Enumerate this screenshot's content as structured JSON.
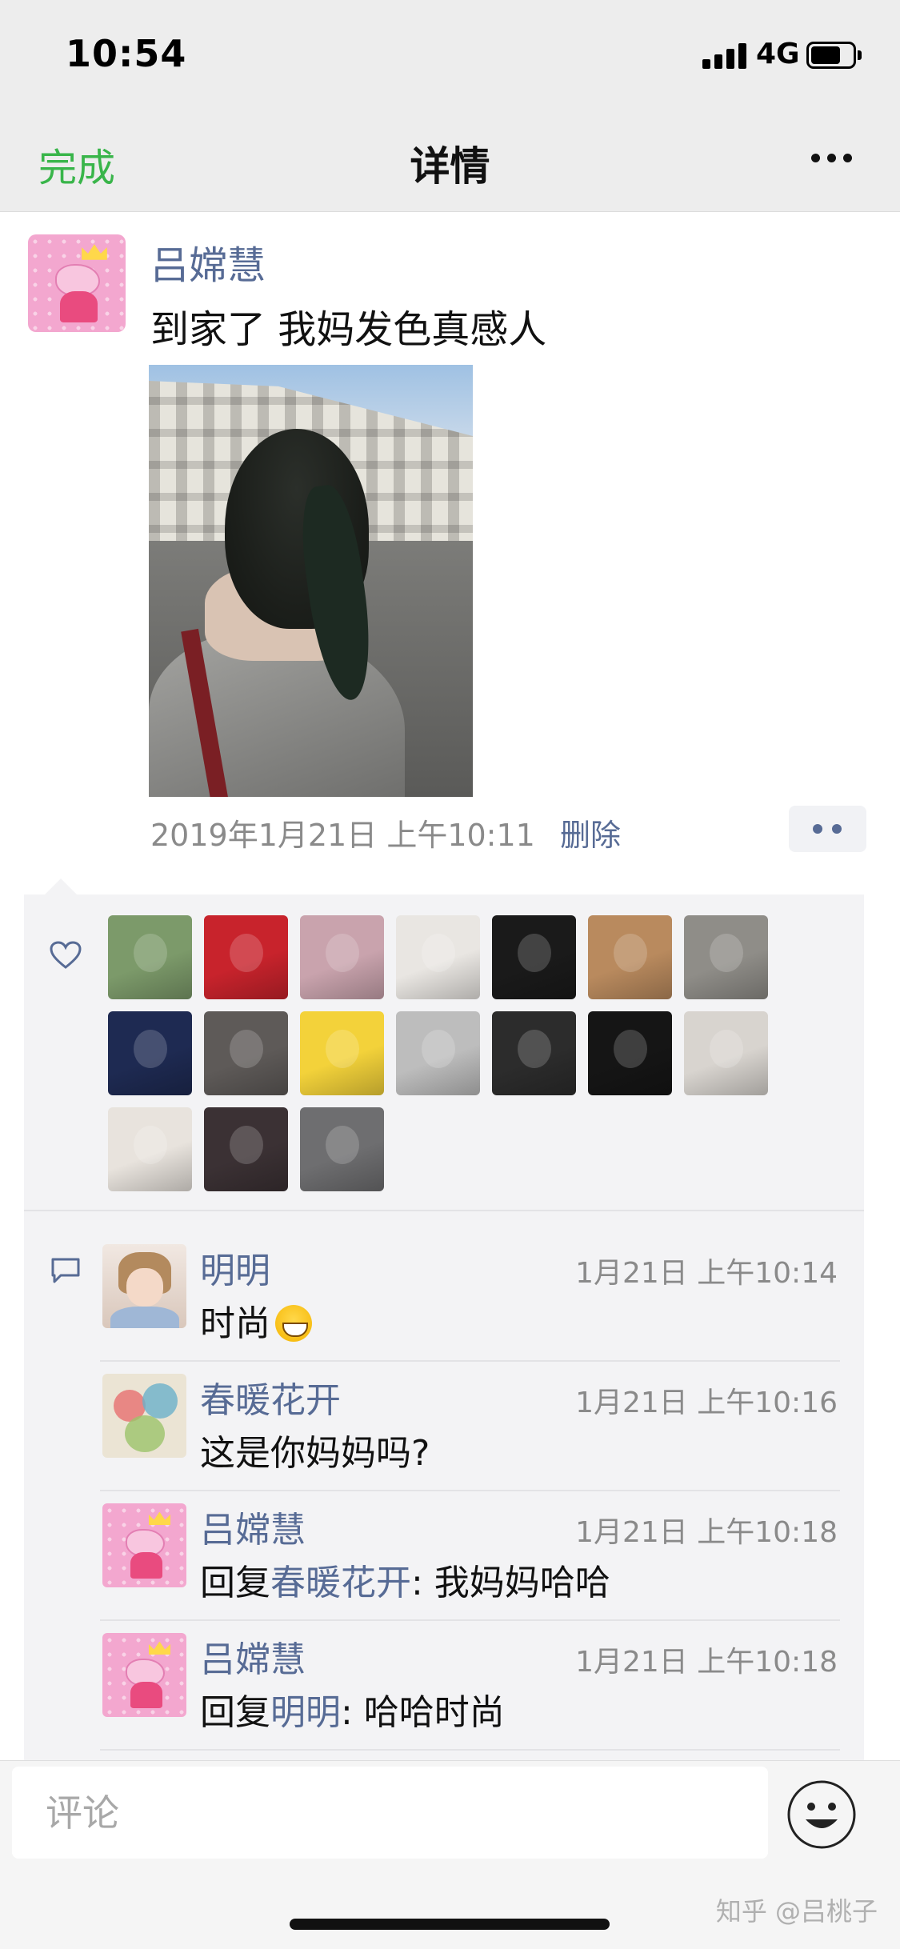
{
  "status_bar": {
    "time": "10:54",
    "network": "4G",
    "battery_level": 0.72
  },
  "nav": {
    "done_label": "完成",
    "title": "详情",
    "more_icon": "more-dots-icon"
  },
  "post": {
    "author": "吕嫦慧",
    "text": "到家了 我妈发色真感人",
    "timestamp": "2019年1月21日 上午10:11",
    "delete_label": "删除",
    "action_icon": "more-dots-icon"
  },
  "likes": {
    "icon": "heart-icon",
    "avatar_colors": [
      "#7c9a6a",
      "#c8232c",
      "#c9a3ad",
      "#e9e6e2",
      "#1a1a1a",
      "#b98a5e",
      "#8f8d88",
      "#1e2a52",
      "#5e5a58",
      "#f3d23a",
      "#bdbdbd",
      "#2c2c2c",
      "#151515",
      "#d8d4cf",
      "#e8e3dd",
      "#3b3134",
      "#6e6e70"
    ]
  },
  "comments": {
    "icon": "comment-icon",
    "items": [
      {
        "name": "明明",
        "time": "1月21日 上午10:14",
        "text": "时尚"
      },
      {
        "name": "春暖花开",
        "time": "1月21日 上午10:16",
        "text": "这是你妈妈吗?"
      },
      {
        "name": "吕嫦慧",
        "time": "1月21日 上午10:18",
        "reply_prefix": "回复",
        "reply_to": "春暖花开",
        "text": ": 我妈妈哈哈"
      },
      {
        "name": "吕嫦慧",
        "time": "1月21日 上午10:18",
        "reply_prefix": "回复",
        "reply_to": "明明",
        "text": ": 哈哈时尚"
      }
    ]
  },
  "input": {
    "placeholder": "评论",
    "emoji_icon": "emoji-face-icon"
  },
  "watermark": "知乎 @吕桃子"
}
